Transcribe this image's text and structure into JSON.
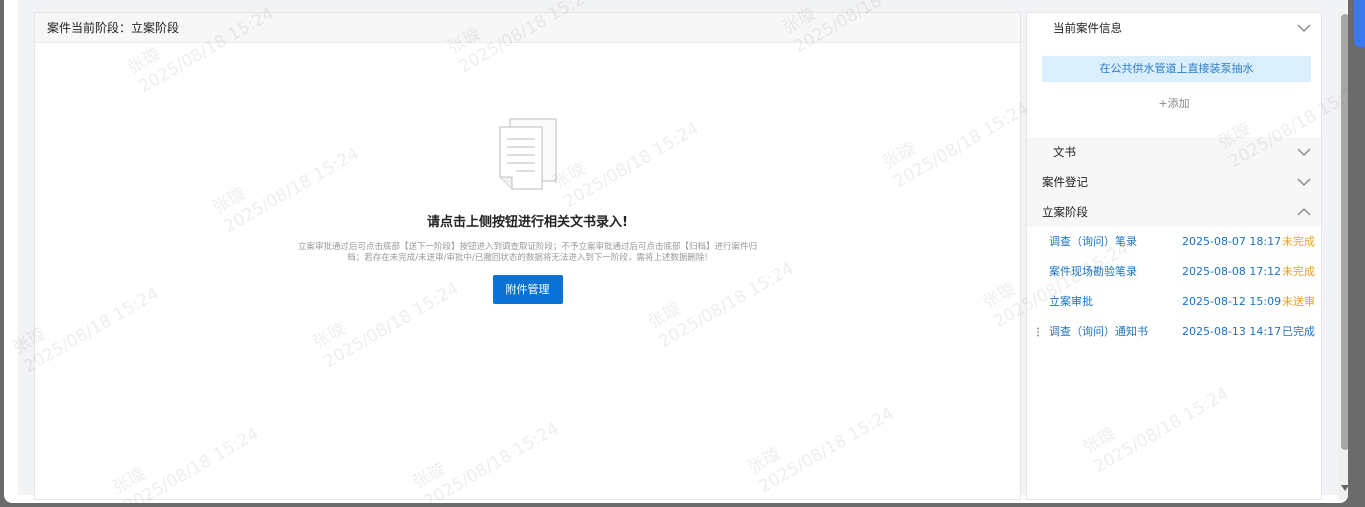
{
  "left": {
    "header": "案件当前阶段：立案阶段",
    "empty_title": "请点击上侧按钮进行相关文书录入!",
    "empty_desc": "立案审批通过后可点击底部【送下一阶段】按钮进入到调查取证阶段；不予立案审批通过后可点击底部【归档】进行案件归档；若存在未完成/未送审/审批中/已撤回状态的数据将无法进入到下一阶段，需将上述数据删除!",
    "attach_button": "附件管理"
  },
  "right": {
    "case_info_title": "当前案件信息",
    "case_tag": "在公共供水管道上直接装泵抽水",
    "add_label": "+添加",
    "section_docs": "文书",
    "section_register": "案件登记",
    "section_stage": "立案阶段",
    "documents": [
      {
        "name": "调查（询问）笔录",
        "date": "2025-08-07 18:17",
        "status": "未完成",
        "status_color": "#e8a317"
      },
      {
        "name": "案件现场勘验笔录",
        "date": "2025-08-08 17:12",
        "status": "未完成",
        "status_color": "#e8a317"
      },
      {
        "name": "立案审批",
        "date": "2025-08-12 15:09",
        "status": "未送审",
        "status_color": "#e8a317"
      },
      {
        "name": "调查（询问）通知书",
        "date": "2025-08-13 14:17",
        "status": "已完成",
        "status_color": "#1a73c8"
      }
    ]
  },
  "watermark": {
    "name": "张璇",
    "time": "2025/08/18 15:24"
  },
  "colors": {
    "primary": "#0a72d4",
    "tag_bg": "#dbeefb",
    "pending": "#e8a317"
  }
}
